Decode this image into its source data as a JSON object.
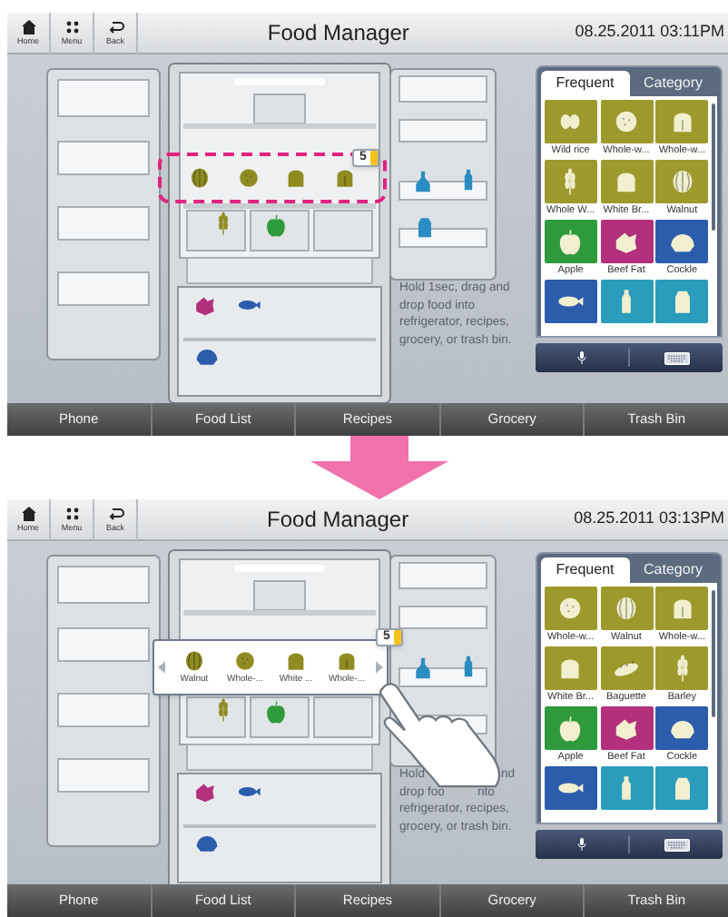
{
  "screens": [
    {
      "header": {
        "buttons": [
          {
            "label": "Home",
            "kind": "home"
          },
          {
            "label": "Menu",
            "kind": "menu"
          },
          {
            "label": "Back",
            "kind": "back"
          }
        ],
        "title": "Food Manager",
        "datetime": "08.25.2011 03:11PM"
      },
      "selection": {
        "kind": "highlight",
        "count": "5",
        "items": [
          {
            "kind": "walnut"
          },
          {
            "kind": "roll"
          },
          {
            "kind": "bread"
          },
          {
            "kind": "whole_bread"
          }
        ]
      },
      "hint": [
        [
          "Hold 1sec, drag and"
        ],
        [
          "drop food into"
        ],
        [
          "refrigerator, recipes,"
        ],
        [
          "grocery, or trash bin."
        ]
      ],
      "panel": {
        "tabs": [
          {
            "label": "Frequent",
            "selected": true
          },
          {
            "label": "Category",
            "selected": false
          }
        ],
        "items": [
          {
            "label": "Wild rice",
            "kind": "grain",
            "color": "#9c9a2c"
          },
          {
            "label": "Whole-w...",
            "kind": "roll",
            "color": "#9c9a2c"
          },
          {
            "label": "Whole-w...",
            "kind": "whole_bread",
            "color": "#9c9a2c"
          },
          {
            "label": "Whole W...",
            "kind": "wheat",
            "color": "#9c9a2c"
          },
          {
            "label": "White Br...",
            "kind": "bread",
            "color": "#9c9a2c"
          },
          {
            "label": "Walnut",
            "kind": "walnut",
            "color": "#9c9a2c"
          },
          {
            "label": "Apple",
            "kind": "apple",
            "color": "#2e9a3c"
          },
          {
            "label": "Beef Fat",
            "kind": "meat",
            "color": "#b3307c"
          },
          {
            "label": "Cockle",
            "kind": "shell",
            "color": "#2c5cac"
          },
          {
            "kind": "fish",
            "color": "#2c5cac"
          },
          {
            "kind": "bottle",
            "color": "#2a9cbc"
          },
          {
            "kind": "carton",
            "color": "#2a9cbc"
          }
        ]
      },
      "nav": [
        "Phone",
        "Food List",
        "Recipes",
        "Grocery",
        "Trash Bin"
      ]
    },
    {
      "header": {
        "buttons": [
          {
            "label": "Home",
            "kind": "home"
          },
          {
            "label": "Menu",
            "kind": "menu"
          },
          {
            "label": "Back",
            "kind": "back"
          }
        ],
        "title": "Food Manager",
        "datetime": "08.25.2011 03:13PM"
      },
      "selection": {
        "kind": "popup",
        "count": "5",
        "items": [
          {
            "kind": "walnut",
            "label": "Walnut"
          },
          {
            "kind": "roll",
            "label": "Whole-..."
          },
          {
            "kind": "bread",
            "label": "White ..."
          },
          {
            "kind": "whole_bread",
            "label": "Whole-..."
          }
        ]
      },
      "hint": [
        [
          "Hold",
          "nd"
        ],
        [
          "drop foo",
          "nto"
        ],
        [
          "refrigerator, recipes,"
        ],
        [
          "grocery, or trash bin."
        ]
      ],
      "panel": {
        "tabs": [
          {
            "label": "Frequent",
            "selected": true
          },
          {
            "label": "Category",
            "selected": false
          }
        ],
        "items": [
          {
            "label": "Whole-w...",
            "kind": "roll",
            "color": "#9c9a2c"
          },
          {
            "label": "Walnut",
            "kind": "walnut",
            "color": "#9c9a2c"
          },
          {
            "label": "Whole-w...",
            "kind": "whole_bread",
            "color": "#9c9a2c"
          },
          {
            "label": "White Br...",
            "kind": "bread",
            "color": "#9c9a2c"
          },
          {
            "label": "Baguette",
            "kind": "baguette",
            "color": "#9c9a2c"
          },
          {
            "label": "Barley",
            "kind": "wheat",
            "color": "#9c9a2c"
          },
          {
            "label": "Apple",
            "kind": "apple",
            "color": "#2e9a3c"
          },
          {
            "label": "Beef Fat",
            "kind": "meat",
            "color": "#b3307c"
          },
          {
            "label": "Cockle",
            "kind": "shell",
            "color": "#2c5cac"
          },
          {
            "kind": "fish",
            "color": "#2c5cac"
          },
          {
            "kind": "bottle",
            "color": "#2a9cbc"
          },
          {
            "kind": "carton",
            "color": "#2a9cbc"
          }
        ]
      },
      "nav": [
        "Phone",
        "Food List",
        "Recipes",
        "Grocery",
        "Trash Bin"
      ]
    }
  ]
}
